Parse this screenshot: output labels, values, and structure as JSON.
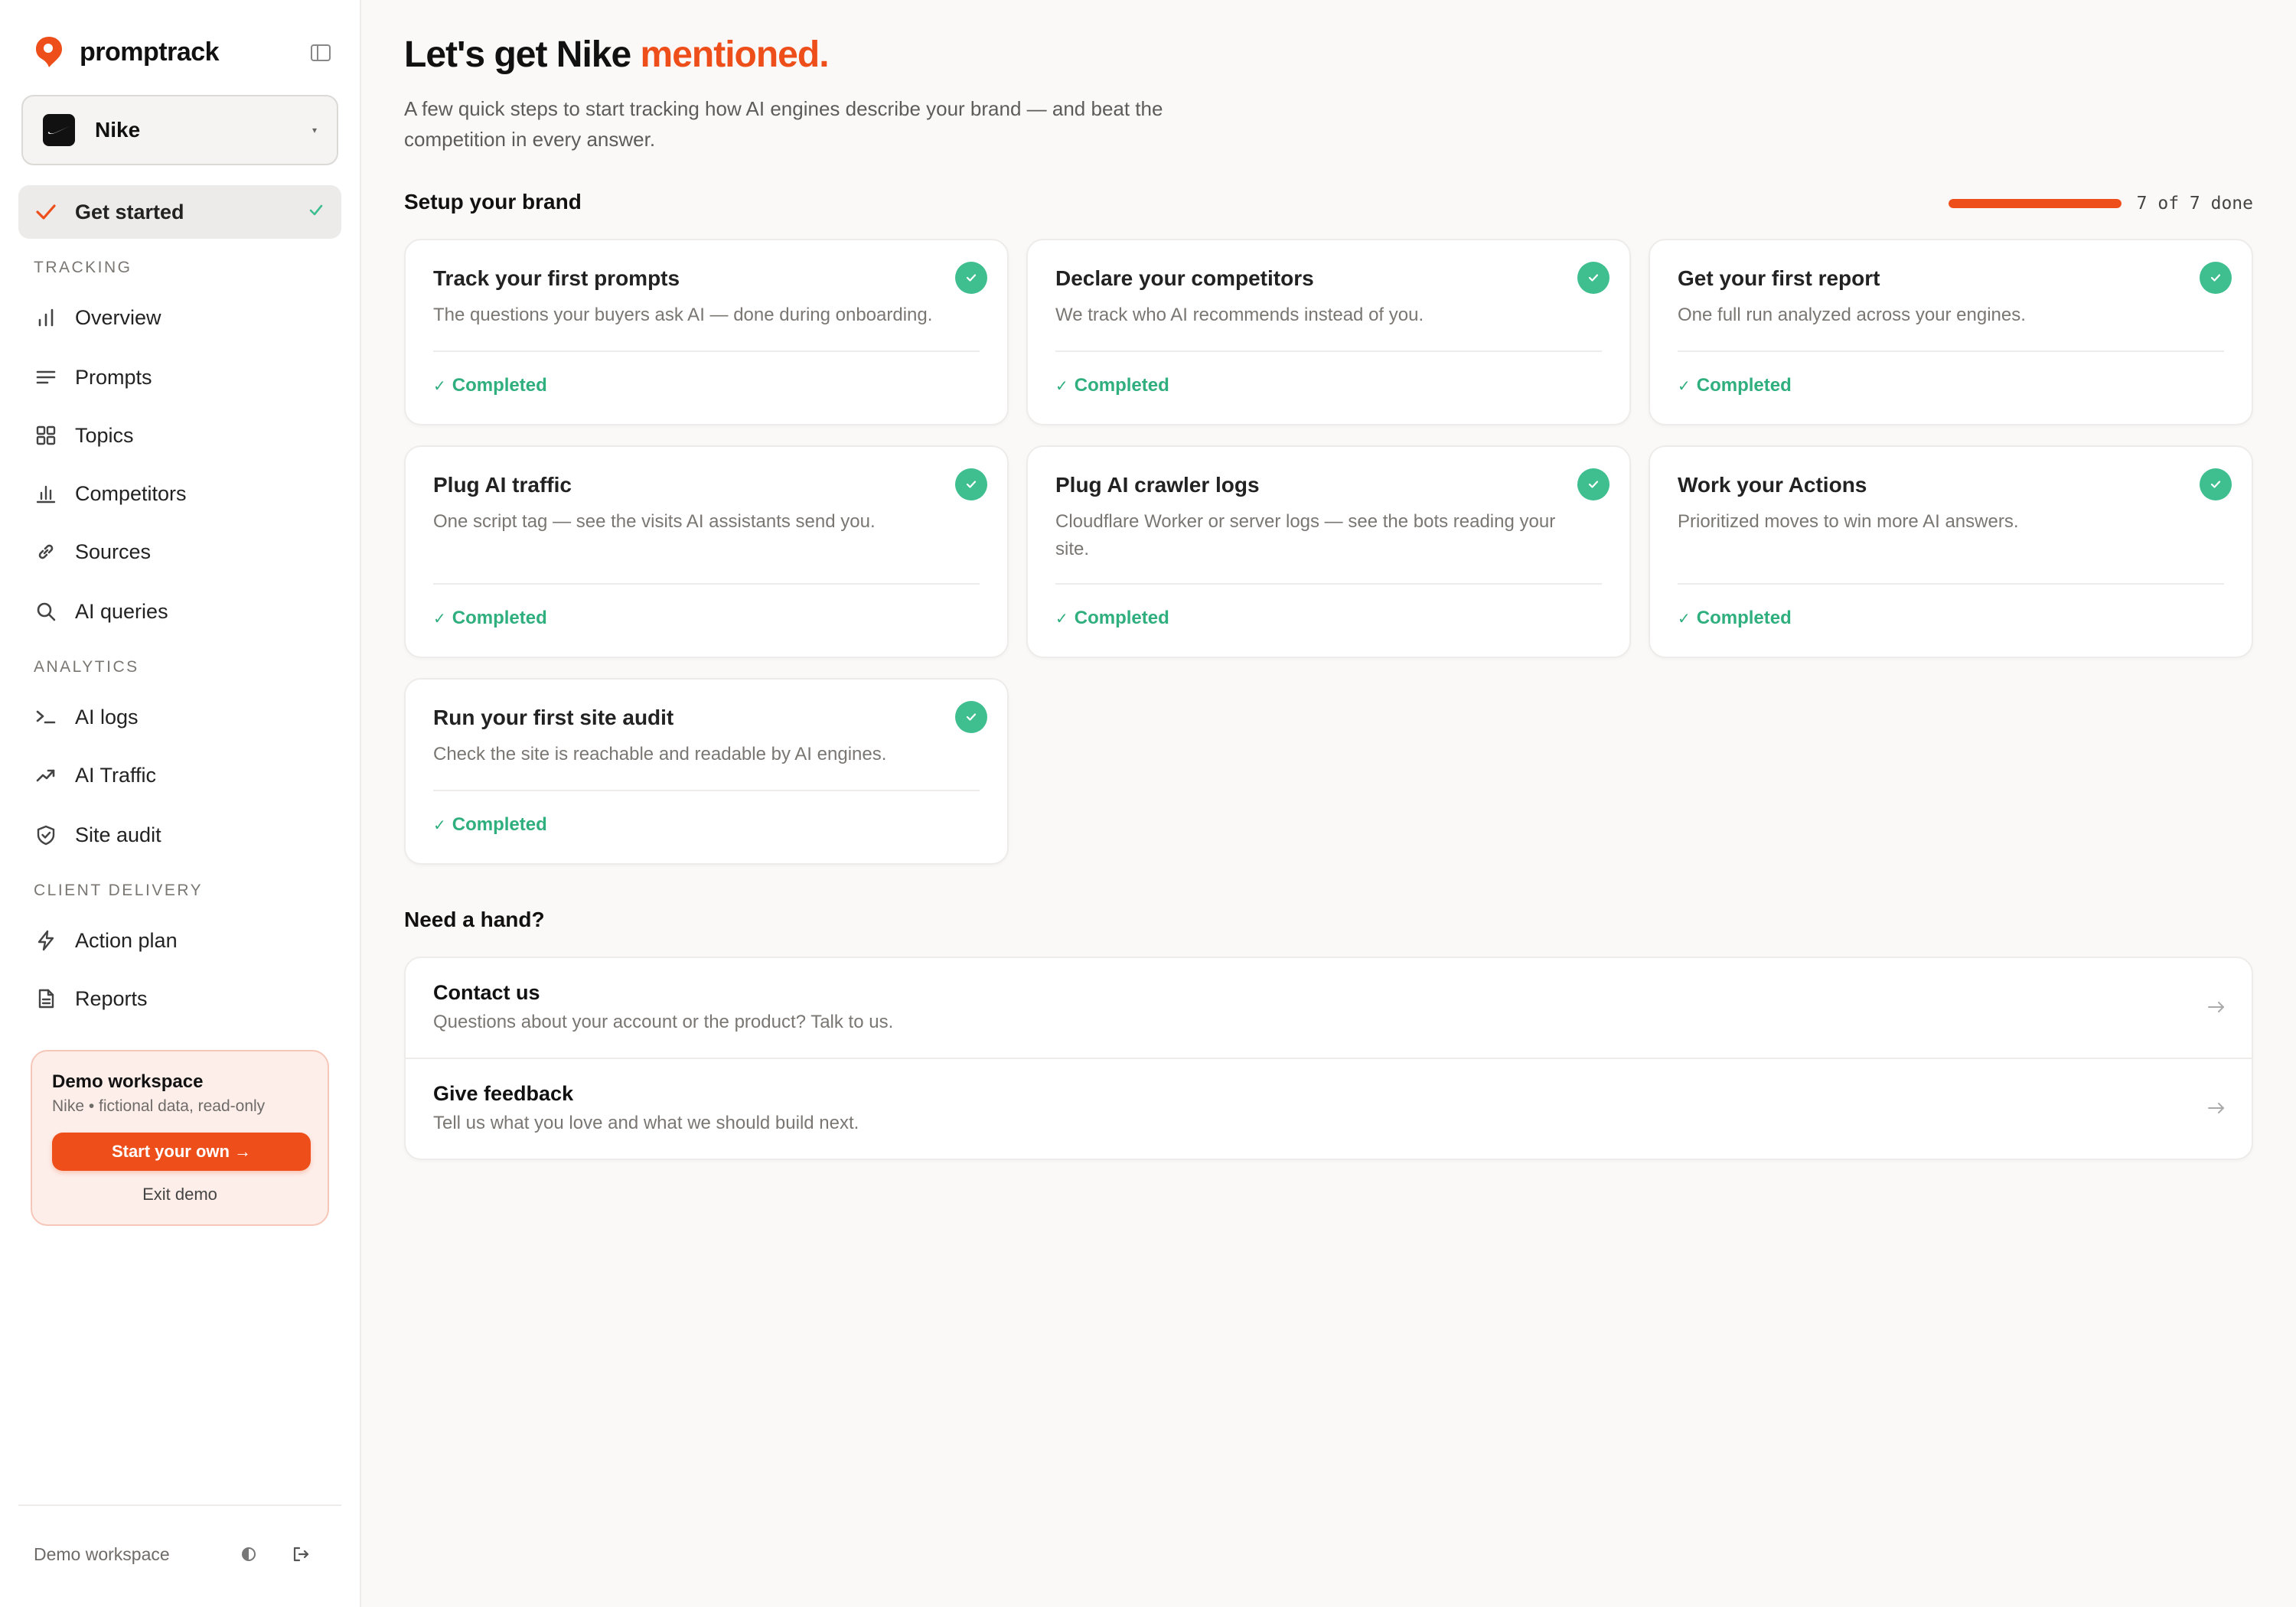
{
  "sidebar": {
    "brand": "promptrack",
    "workspace": {
      "name": "Nike"
    },
    "get_started": "Get started",
    "sections": {
      "tracking": "TRACKING",
      "analytics": "ANALYTICS",
      "client_delivery": "CLIENT DELIVERY"
    },
    "tracking_items": [
      {
        "label": "Overview",
        "icon": "bar-chart-icon"
      },
      {
        "label": "Prompts",
        "icon": "lines-icon"
      },
      {
        "label": "Topics",
        "icon": "grid-icon"
      },
      {
        "label": "Competitors",
        "icon": "column-chart-icon"
      },
      {
        "label": "Sources",
        "icon": "link-icon"
      },
      {
        "label": "AI queries",
        "icon": "search-icon"
      }
    ],
    "analytics_items": [
      {
        "label": "AI logs",
        "icon": "terminal-icon"
      },
      {
        "label": "AI Traffic",
        "icon": "trending-up-icon"
      },
      {
        "label": "Site audit",
        "icon": "shield-check-icon"
      }
    ],
    "delivery_items": [
      {
        "label": "Action plan",
        "icon": "bolt-icon"
      },
      {
        "label": "Reports",
        "icon": "document-icon"
      }
    ],
    "demo": {
      "title": "Demo workspace",
      "subtitle": "Nike • fictional data, read-only",
      "cta": "Start your own →",
      "exit": "Exit demo"
    },
    "footer": {
      "label": "Demo workspace"
    }
  },
  "main": {
    "title_prefix": "Let's get Nike ",
    "title_accent": "mentioned.",
    "subtitle": "A few quick steps to start tracking how AI engines describe your brand — and beat the competition in every answer.",
    "setup_title": "Setup your brand",
    "progress": {
      "done": 7,
      "total": 7,
      "text": "7 of 7 done"
    },
    "steps": [
      {
        "title": "Track your first prompts",
        "desc": "The questions your buyers ask AI — done during onboarding.",
        "status": "Completed"
      },
      {
        "title": "Declare your competitors",
        "desc": "We track who AI recommends instead of you.",
        "status": "Completed"
      },
      {
        "title": "Get your first report",
        "desc": "One full run analyzed across your engines.",
        "status": "Completed"
      },
      {
        "title": "Plug AI traffic",
        "desc": "One script tag — see the visits AI assistants send you.",
        "status": "Completed"
      },
      {
        "title": "Plug AI crawler logs",
        "desc": "Cloudflare Worker or server logs — see the bots reading your site.",
        "status": "Completed"
      },
      {
        "title": "Work your Actions",
        "desc": "Prioritized moves to win more AI answers.",
        "status": "Completed"
      },
      {
        "title": "Run your first site audit",
        "desc": "Check the site is reachable and readable by AI engines.",
        "status": "Completed"
      }
    ],
    "help_title": "Need a hand?",
    "help": [
      {
        "title": "Contact us",
        "desc": "Questions about your account or the product? Talk to us."
      },
      {
        "title": "Give feedback",
        "desc": "Tell us what you love and what we should build next."
      }
    ]
  },
  "colors": {
    "accent": "#ee4e1a",
    "success": "#3fbf8f",
    "background": "#faf9f7"
  }
}
